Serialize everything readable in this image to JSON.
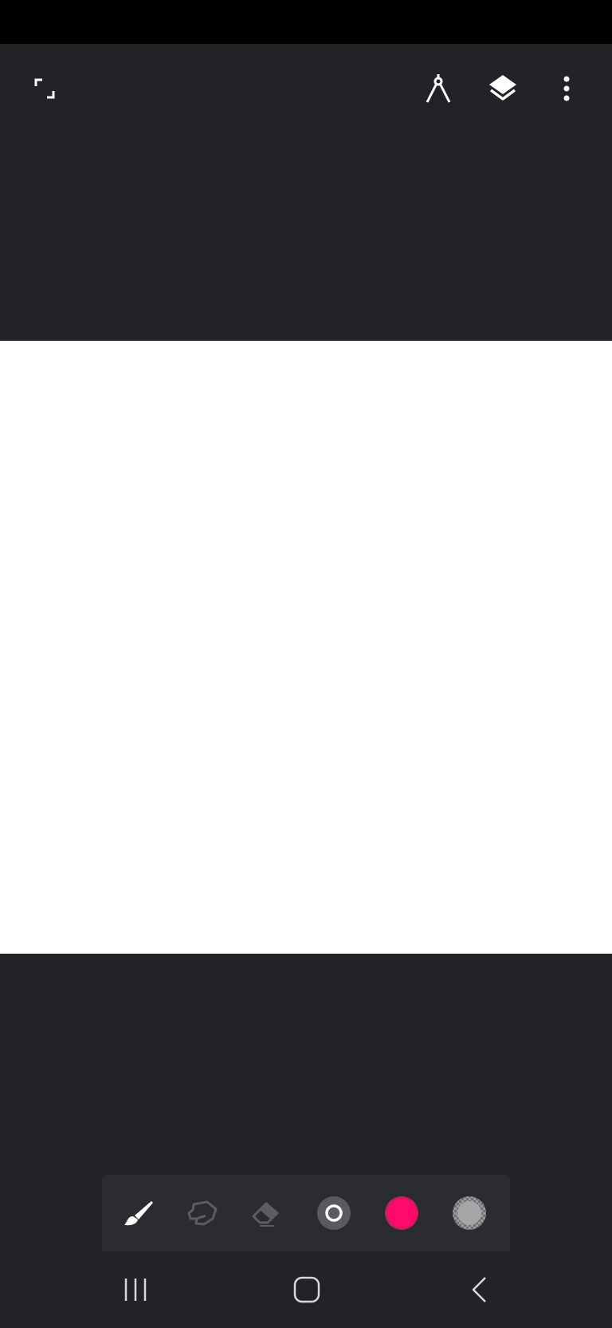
{
  "app": {
    "canvas_color": "#ffffff",
    "background_color": "#222326"
  },
  "top_toolbar": {
    "buttons": [
      {
        "icon": "fullscreen-icon"
      },
      {
        "icon": "ruler-compass-icon"
      },
      {
        "icon": "layers-icon"
      },
      {
        "icon": "more-vert-icon"
      }
    ]
  },
  "tool_dock": {
    "tools": [
      {
        "icon": "brush-icon",
        "state": "selected"
      },
      {
        "icon": "smudge-icon",
        "state": "inactive"
      },
      {
        "icon": "eraser-icon",
        "state": "inactive"
      },
      {
        "icon": "brush-size-icon",
        "state": "normal"
      },
      {
        "icon": "color-swatch-icon",
        "color": "#ff0a6c"
      },
      {
        "icon": "opacity-icon",
        "color": "#a6a6a6"
      }
    ]
  },
  "nav_bar": {
    "buttons": [
      {
        "icon": "recent-apps-icon"
      },
      {
        "icon": "home-icon"
      },
      {
        "icon": "back-icon"
      }
    ]
  }
}
